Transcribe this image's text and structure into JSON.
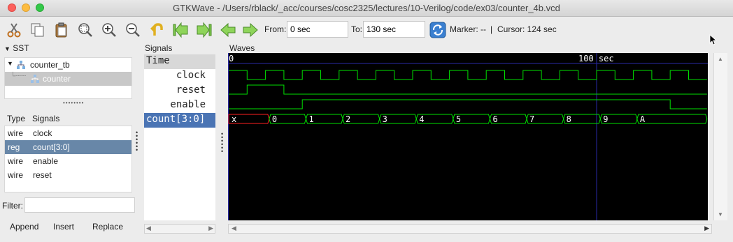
{
  "window": {
    "title": "GTKWave - /Users/rblack/_acc/courses/cosc2325/lectures/10-Verilog/code/ex03/counter_4b.vcd"
  },
  "toolbar": {
    "from_label": "From:",
    "from_value": "0 sec",
    "to_label": "To:",
    "to_value": "130 sec",
    "marker_label": "Marker: --",
    "separator": "|",
    "cursor_label": "Cursor: 124 sec",
    "icons": [
      "cut-icon",
      "copy-icon",
      "paste-icon",
      "zoom-fit-icon",
      "zoom-in-icon",
      "zoom-out-icon",
      "undo-icon",
      "first-icon",
      "last-icon",
      "prev-icon",
      "next-icon",
      "reload-icon"
    ]
  },
  "sst": {
    "header": "SST",
    "tree": [
      {
        "label": "counter_tb"
      },
      {
        "label": "counter"
      }
    ],
    "type_header": "Type",
    "signals_header": "Signals",
    "signals": [
      {
        "type": "wire",
        "name": "clock"
      },
      {
        "type": "reg",
        "name": "count[3:0]"
      },
      {
        "type": "wire",
        "name": "enable"
      },
      {
        "type": "wire",
        "name": "reset"
      }
    ],
    "filter_label": "Filter:",
    "filter_value": ""
  },
  "buttons": {
    "append": "Append",
    "insert": "Insert",
    "replace": "Replace"
  },
  "signals_pane": {
    "header": "Signals",
    "time_label": "Time",
    "rows": [
      "clock",
      "reset",
      "enable",
      "count[3:0]"
    ]
  },
  "waves": {
    "header": "Waves",
    "time_start": "0",
    "time_mark": "100 sec",
    "time_range": [
      0,
      130
    ],
    "cursor_time": 124,
    "clock_half_period": 5,
    "reset": [
      {
        "t": 5,
        "v": 1
      },
      {
        "t": 15,
        "v": 0
      }
    ],
    "enable": [
      {
        "t": 20,
        "v": 1
      },
      {
        "t": 120,
        "v": 0
      }
    ],
    "count_values": [
      {
        "t": 0,
        "v": "x"
      },
      {
        "t": 11,
        "v": "0"
      },
      {
        "t": 21,
        "v": "1"
      },
      {
        "t": 31,
        "v": "2"
      },
      {
        "t": 41,
        "v": "3"
      },
      {
        "t": 51,
        "v": "4"
      },
      {
        "t": 61,
        "v": "5"
      },
      {
        "t": 71,
        "v": "6"
      },
      {
        "t": 81,
        "v": "7"
      },
      {
        "t": 91,
        "v": "8"
      },
      {
        "t": 101,
        "v": "9"
      },
      {
        "t": 111,
        "v": "A"
      }
    ],
    "colors": {
      "signal": "#00e000",
      "undefined": "#ff2020",
      "grid": "#2a2aa8",
      "text": "#ffffff"
    }
  }
}
